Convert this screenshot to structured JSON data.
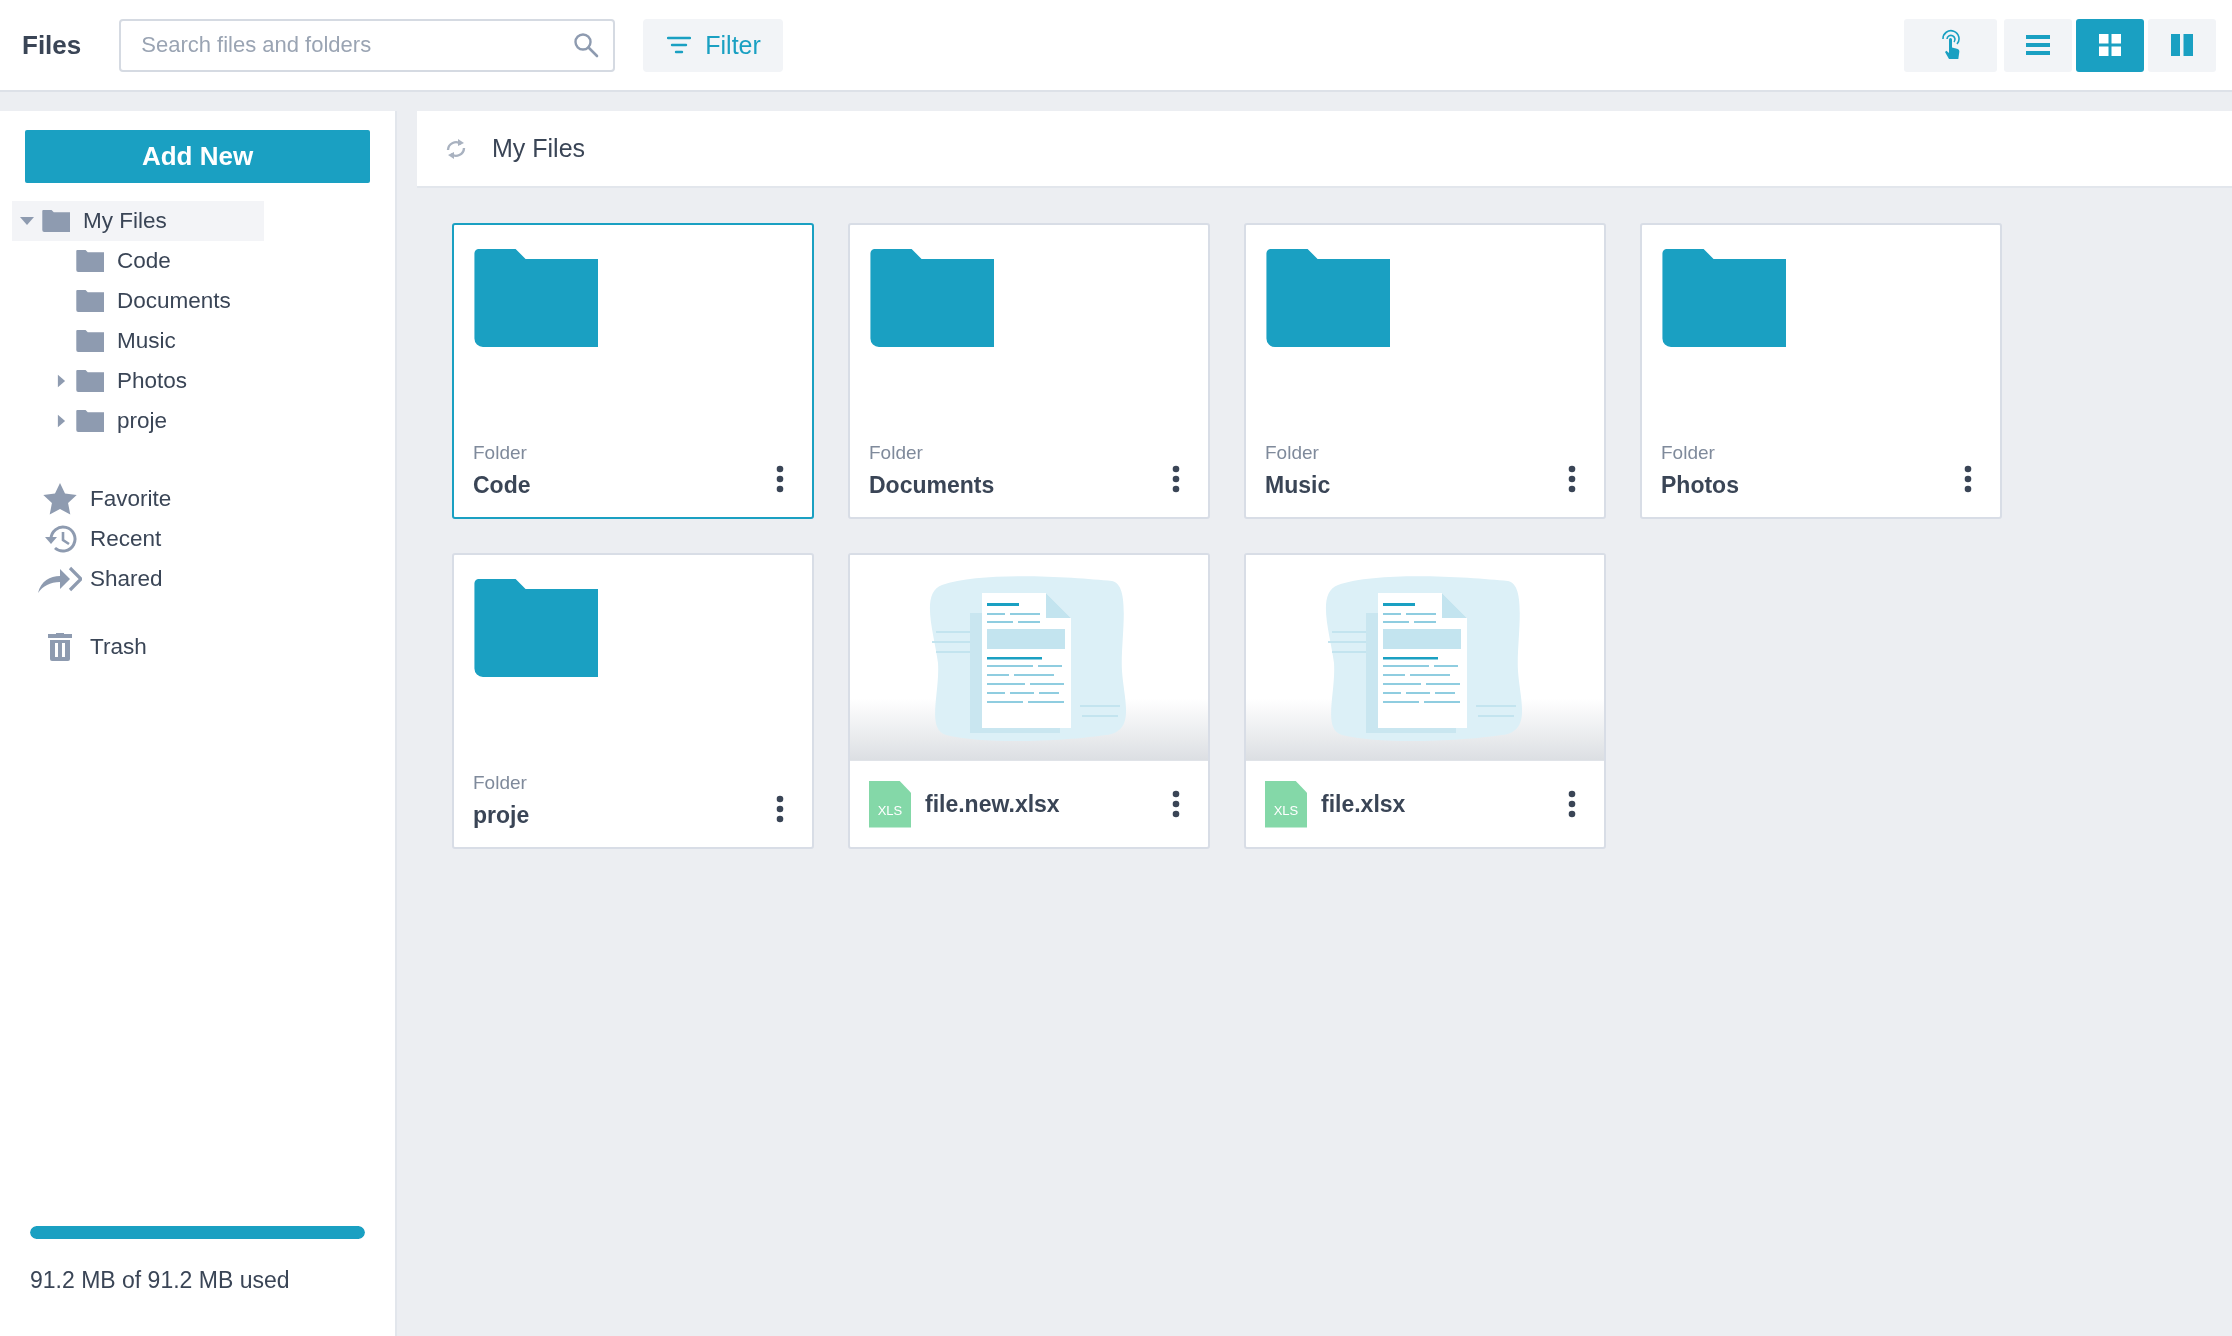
{
  "app_title": "Files",
  "search": {
    "placeholder": "Search files and folders"
  },
  "filter_button": "Filter",
  "view_buttons": [
    {
      "kind": "touch",
      "selected": false
    },
    {
      "kind": "list",
      "selected": false
    },
    {
      "kind": "grid",
      "selected": true
    },
    {
      "kind": "columns",
      "selected": false
    }
  ],
  "sidebar": {
    "add_button": "Add New",
    "tree": [
      {
        "label": "My Files",
        "expanded": true,
        "selected": true,
        "children": [
          {
            "label": "Code",
            "selected": false
          },
          {
            "label": "Documents",
            "selected": false
          },
          {
            "label": "Music",
            "selected": false
          },
          {
            "label": "Photos",
            "expanded": false,
            "selected": false
          },
          {
            "label": "proje",
            "expanded": false,
            "selected": false
          }
        ]
      }
    ],
    "places": [
      {
        "kind": "favorite",
        "label": "Favorite"
      },
      {
        "kind": "recent",
        "label": "Recent"
      },
      {
        "kind": "shared",
        "label": "Shared"
      },
      {
        "kind": "trash",
        "label": "Trash"
      }
    ],
    "storage": {
      "level": 1,
      "text": "91.2 MB of 91.2 MB used"
    }
  },
  "main": {
    "title": "My Files",
    "items": [
      {
        "kind": "folder",
        "type_label": "Folder",
        "name": "Code",
        "selected": true
      },
      {
        "kind": "folder",
        "type_label": "Folder",
        "name": "Documents",
        "selected": false
      },
      {
        "kind": "folder",
        "type_label": "Folder",
        "name": "Music",
        "selected": false
      },
      {
        "kind": "folder",
        "type_label": "Folder",
        "name": "Photos",
        "selected": false
      },
      {
        "kind": "folder",
        "type_label": "Folder",
        "name": "proje",
        "selected": false
      },
      {
        "kind": "spreadsheet",
        "badge": "XLS",
        "name": "file.new.xlsx",
        "selected": false
      },
      {
        "kind": "spreadsheet",
        "badge": "XLS",
        "name": "file.xlsx",
        "selected": false
      }
    ]
  }
}
